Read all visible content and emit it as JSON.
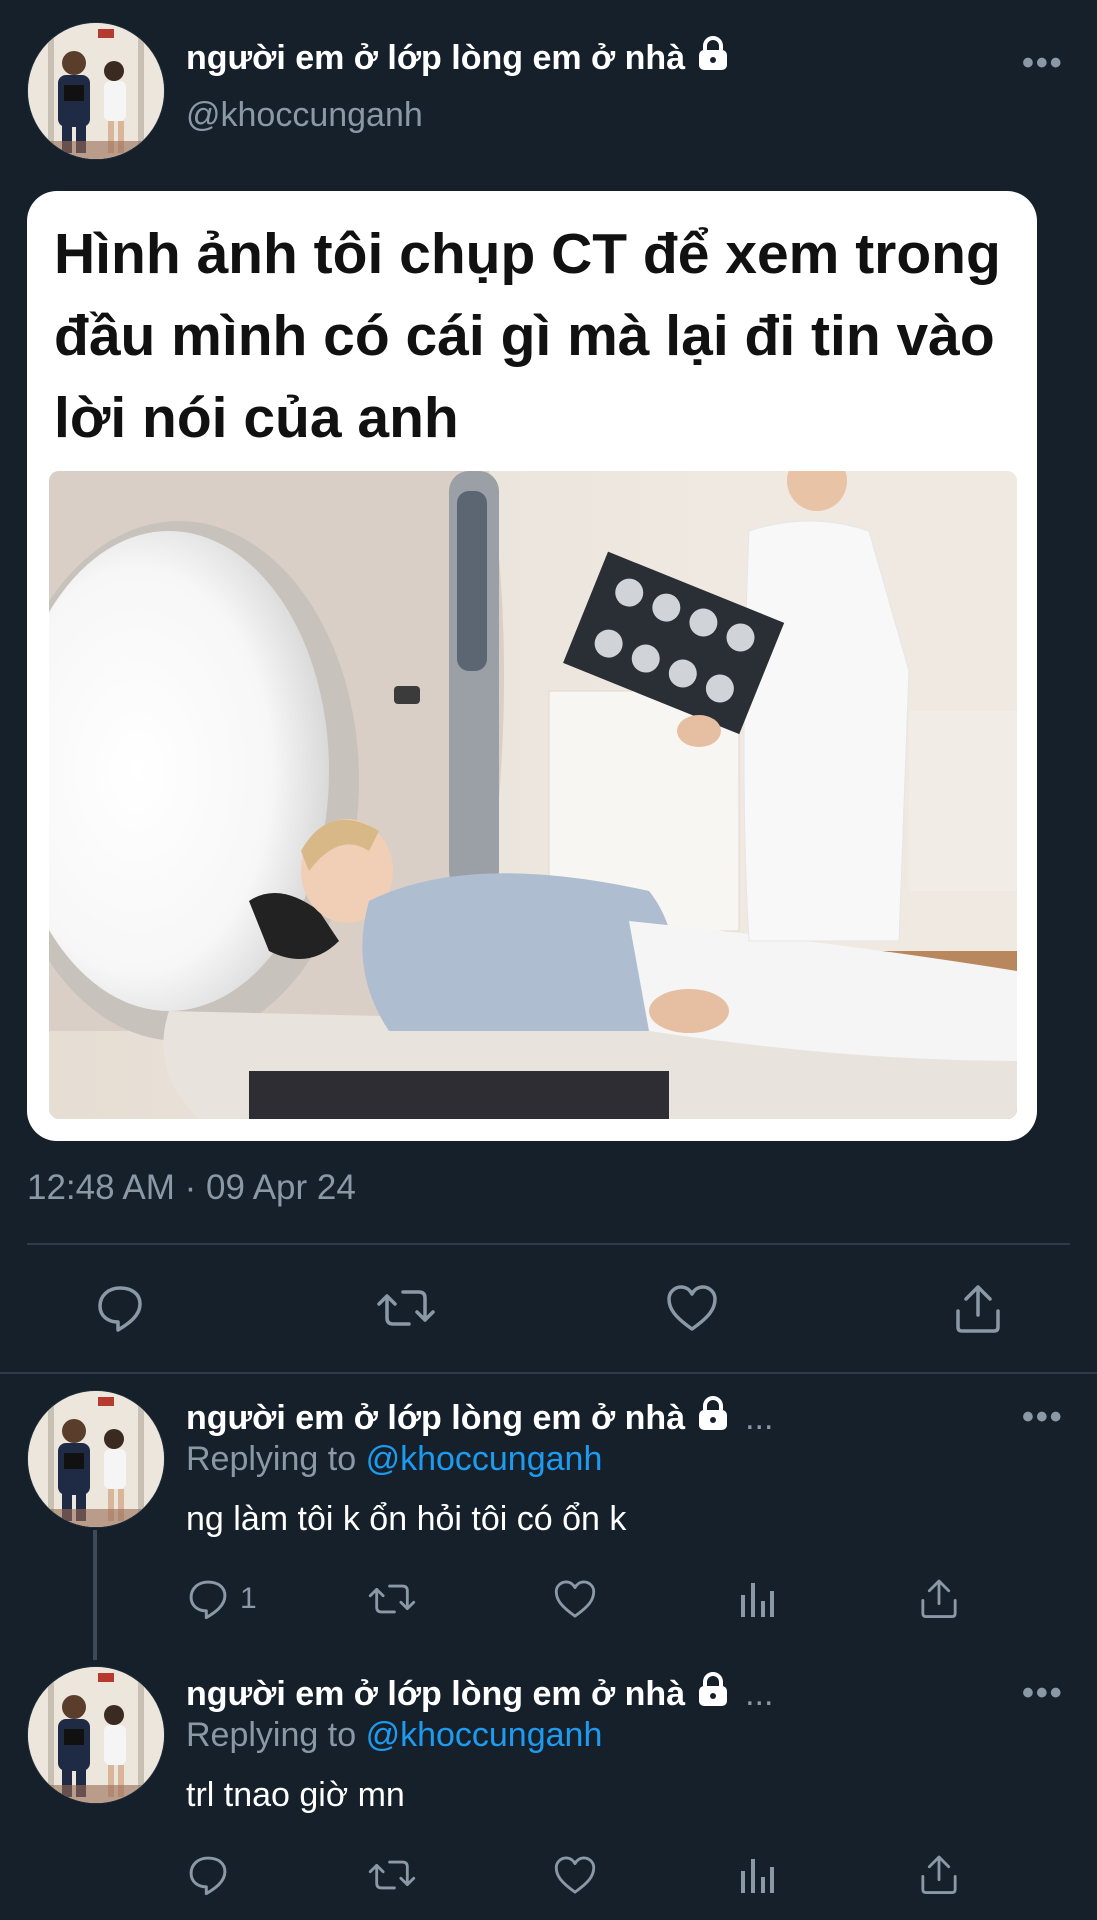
{
  "main_tweet": {
    "display_name": "người em ở lớp lòng em ở nhà",
    "handle": "@khoccunganh",
    "more_label": "•••",
    "meme_text": "Hình ảnh tôi chụp CT để xem trong đầu mình có cái gì mà lại đi tin vào lời nói của anh",
    "timestamp": "12:48 AM · 09 Apr 24",
    "actions": [
      "reply-icon",
      "retweet-icon",
      "like-icon",
      "share-icon"
    ]
  },
  "replies": [
    {
      "display_name": "người em ở lớp lòng em ở nhà",
      "ellipsis": "...",
      "replying_prefix": "Replying to",
      "replying_handle": "@khoccunganh",
      "text": "ng làm tôi k ổn hỏi tôi có ổn k",
      "reply_count": "1",
      "more_label": "•••"
    },
    {
      "display_name": "người em ở lớp lòng em ở nhà",
      "ellipsis": "...",
      "replying_prefix": "Replying to",
      "replying_handle": "@khoccunganh",
      "text": "trl tnao giờ mn",
      "reply_count": "",
      "more_label": "•••"
    }
  ],
  "colors": {
    "background": "#15202b",
    "secondary_text": "#8b98a5",
    "link": "#1d9bf0"
  }
}
